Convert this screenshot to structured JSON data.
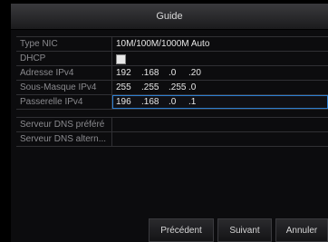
{
  "window": {
    "title": "Guide"
  },
  "fields": [
    {
      "label": "Type NIC",
      "value": "10M/100M/1000M Auto"
    },
    {
      "label": "DHCP",
      "checked": false
    },
    {
      "label": "Adresse IPv4",
      "octets": [
        "192",
        ".168",
        ".0",
        ".20"
      ]
    },
    {
      "label": "Sous-Masque IPv4",
      "octets": [
        "255",
        ".255",
        ".255",
        ".0"
      ]
    },
    {
      "label": "Passerelle  IPv4",
      "octets": [
        "196",
        ".168",
        ".0",
        ".1"
      ]
    },
    {
      "label": "Serveur DNS préféré",
      "value": ""
    },
    {
      "label": "Serveur DNS altern...",
      "value": ""
    }
  ],
  "buttons": {
    "previous": "Précédent",
    "next": "Suivant",
    "cancel": "Annuler"
  }
}
